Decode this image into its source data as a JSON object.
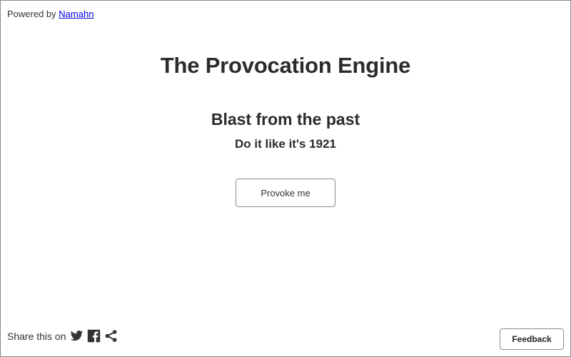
{
  "header": {
    "powered_by_label": "Powered by",
    "powered_by_link": "Namahn"
  },
  "main": {
    "title": "The Provocation Engine",
    "subtitle": "Blast from the past",
    "tagline": "Do it like it's 1921",
    "provoke_button_label": "Provoke me"
  },
  "footer": {
    "share_label": "Share this on",
    "share_icons": [
      "twitter-icon",
      "facebook-icon",
      "share-icon"
    ],
    "feedback_button_label": "Feedback"
  },
  "colors": {
    "text": "#333333",
    "link": "#0000ee",
    "border": "#8a8a8a",
    "background": "#ffffff"
  }
}
